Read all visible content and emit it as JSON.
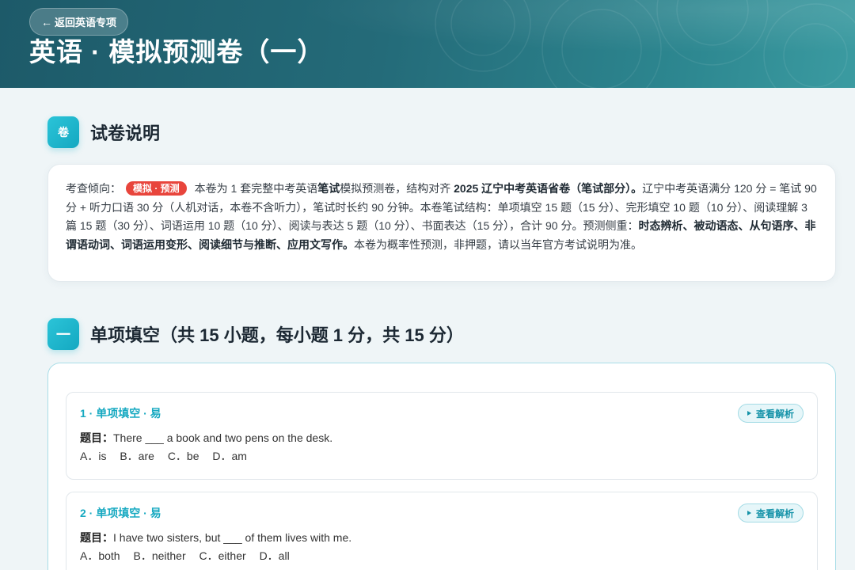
{
  "header": {
    "back_button": {
      "arrow": "←",
      "label": "返回英语专项"
    },
    "title": "英语 · 模拟预测卷（一）"
  },
  "intro_section": {
    "icon_text": "卷",
    "title": "试卷说明",
    "tendency_label": "考查倾向：",
    "badge": "模拟 · 预测",
    "text_1": "本卷为 1 套完整中考英语",
    "bold_1": "笔试",
    "text_2": "模拟预测卷，结构对齐 ",
    "bold_2": "2025 辽宁中考英语省卷（笔试部分）。",
    "text_3": "辽宁中考英语满分 120 分 = 笔试 90 分 + 听力口语 30 分（人机对话，本卷不含听力），笔试时长约 90 分钟。本卷笔试结构：单项填空 15 题（15 分）、完形填空 10 题（10 分）、阅读理解 3 篇 15 题（30 分）、词语运用 10 题（10 分）、阅读与表达 5 题（10 分）、书面表达（15 分），合计 90 分。预测侧重：",
    "bold_3": "时态辨析、被动语态、从句语序、非谓语动词、词语运用变形、阅读细节与推断、应用文写作。",
    "text_4": "本卷为概率性预测，非押题，请以当年官方考试说明为准。"
  },
  "single_choice_section": {
    "icon_text": "一",
    "title": "单项填空（共 15 小题，每小题 1 分，共 15 分）",
    "questions": [
      {
        "meta": "1 · 单项填空 · 易",
        "analysis_icon": "caret-right-icon",
        "analysis_button": "查看解析",
        "stem_label": "题目：",
        "stem": "There ___ a book and two pens on the desk.",
        "options": [
          "A．is",
          "B．are",
          "C．be",
          "D．am"
        ]
      },
      {
        "meta": "2 · 单项填空 · 易",
        "analysis_icon": "caret-right-icon",
        "analysis_button": "查看解析",
        "stem_label": "题目：",
        "stem": "I have two sisters, but ___ of them lives with me.",
        "options": [
          "A．both",
          "B．neither",
          "C．either",
          "D．all"
        ]
      }
    ]
  },
  "colors": {
    "header_start": "#1d5a69",
    "header_mid": "#246b79",
    "header_end": "#3b9ba1",
    "accent": "#1ab3c9",
    "badge_red": "#e8453c",
    "page_background": "#eff5f7"
  }
}
